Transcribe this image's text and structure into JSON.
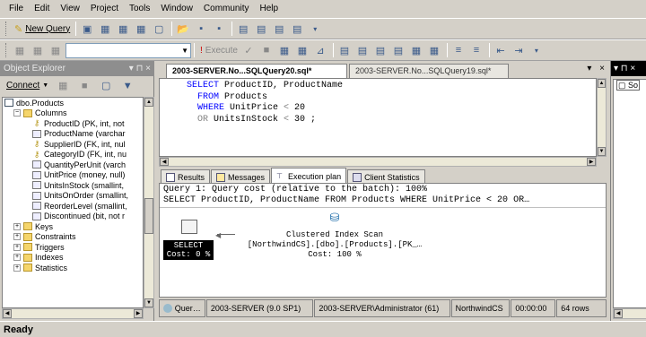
{
  "menu": [
    "File",
    "Edit",
    "View",
    "Project",
    "Tools",
    "Window",
    "Community",
    "Help"
  ],
  "toolbar1": {
    "new_query_label": "New Query"
  },
  "toolbar2": {
    "execute_label": "Execute",
    "database": ""
  },
  "object_explorer": {
    "title": "Object Explorer",
    "connect_label": "Connect",
    "tree": [
      {
        "label": "dbo.Products",
        "kind": "table",
        "indent": 0,
        "toggle": ""
      },
      {
        "label": "Columns",
        "kind": "folder",
        "indent": 1,
        "toggle": "−"
      },
      {
        "label": "ProductID (PK, int, not",
        "kind": "key",
        "indent": 2,
        "toggle": ""
      },
      {
        "label": "ProductName (varchar",
        "kind": "col",
        "indent": 2,
        "toggle": ""
      },
      {
        "label": "SupplierID (FK, int, nul",
        "kind": "key",
        "indent": 2,
        "toggle": ""
      },
      {
        "label": "CategoryID (FK, int, nu",
        "kind": "key",
        "indent": 2,
        "toggle": ""
      },
      {
        "label": "QuantityPerUnit (varch",
        "kind": "col",
        "indent": 2,
        "toggle": ""
      },
      {
        "label": "UnitPrice (money, null)",
        "kind": "col",
        "indent": 2,
        "toggle": ""
      },
      {
        "label": "UnitsInStock (smallint,",
        "kind": "col",
        "indent": 2,
        "toggle": ""
      },
      {
        "label": "UnitsOnOrder (smallint,",
        "kind": "col",
        "indent": 2,
        "toggle": ""
      },
      {
        "label": "ReorderLevel (smallint,",
        "kind": "col",
        "indent": 2,
        "toggle": ""
      },
      {
        "label": "Discontinued (bit, not r",
        "kind": "col",
        "indent": 2,
        "toggle": ""
      },
      {
        "label": "Keys",
        "kind": "folder",
        "indent": 1,
        "toggle": "+"
      },
      {
        "label": "Constraints",
        "kind": "folder",
        "indent": 1,
        "toggle": "+"
      },
      {
        "label": "Triggers",
        "kind": "folder",
        "indent": 1,
        "toggle": "+"
      },
      {
        "label": "Indexes",
        "kind": "folder",
        "indent": 1,
        "toggle": "+"
      },
      {
        "label": "Statistics",
        "kind": "folder",
        "indent": 1,
        "toggle": "+"
      }
    ]
  },
  "document": {
    "tabs": [
      {
        "label": "2003-SERVER.No...SQLQuery20.sql*"
      },
      {
        "label": "2003-SERVER.No...SQLQuery19.sql*"
      }
    ],
    "code": [
      [
        {
          "t": "SELECT",
          "c": "kw"
        },
        {
          "t": " ProductID, ProductName",
          "c": ""
        }
      ],
      [
        {
          "t": "  FROM",
          "c": "kw"
        },
        {
          "t": " Products",
          "c": ""
        }
      ],
      [
        {
          "t": "  WHERE",
          "c": "kw"
        },
        {
          "t": " UnitPrice ",
          "c": ""
        },
        {
          "t": "<",
          "c": "op"
        },
        {
          "t": " 20",
          "c": ""
        }
      ],
      [
        {
          "t": "  OR",
          "c": "op"
        },
        {
          "t": " UnitsInStock ",
          "c": ""
        },
        {
          "t": "<",
          "c": "op"
        },
        {
          "t": " 30 ;",
          "c": ""
        }
      ]
    ],
    "result_tabs": [
      "Results",
      "Messages",
      "Execution plan",
      "Client Statistics"
    ],
    "plan": {
      "line1": "Query 1: Query cost (relative to the batch): 100%",
      "line2": "SELECT ProductID, ProductName FROM Products WHERE UnitPrice < 20 OR…",
      "select_label": "SELECT",
      "select_cost": "Cost: 0 %",
      "scan_title": "Clustered Index Scan",
      "scan_object": "[NorthwindCS].[dbo].[Products].[PK_…",
      "scan_cost": "Cost: 100 %"
    },
    "status": {
      "state": "Quer…",
      "server": "2003-SERVER (9.0 SP1)",
      "user": "2003-SERVER\\Administrator (61)",
      "database": "NorthwindCS",
      "time": "00:00:00",
      "rows": "64 rows"
    }
  },
  "right_panel": {
    "title": "▾ ⊓ ×",
    "item": "So"
  },
  "statusbar": {
    "text": "Ready"
  }
}
